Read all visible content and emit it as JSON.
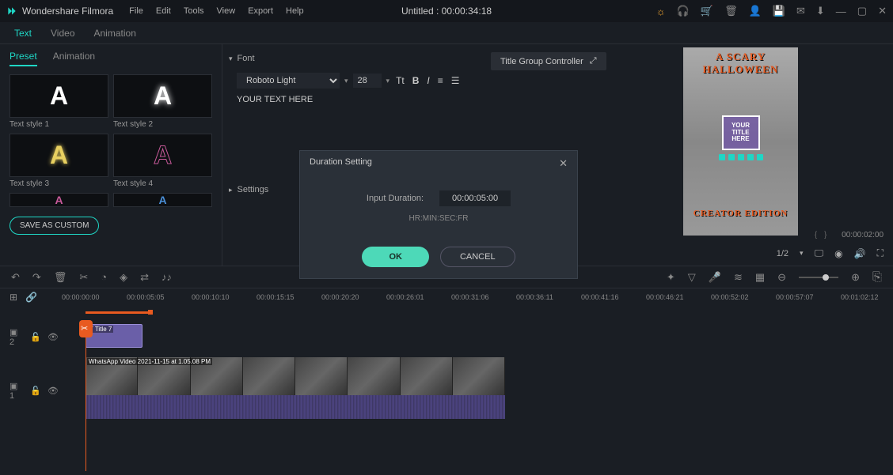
{
  "titlebar": {
    "app_name": "Wondershare Filmora",
    "menu": [
      "File",
      "Edit",
      "Tools",
      "View",
      "Export",
      "Help"
    ],
    "document_title": "Untitled : 00:00:34:18"
  },
  "main_tabs": {
    "items": [
      "Text",
      "Video",
      "Animation"
    ],
    "active": "Text"
  },
  "sub_tabs": {
    "items": [
      "Preset",
      "Animation"
    ],
    "active": "Preset"
  },
  "presets": [
    {
      "label": "Text style 1",
      "glyph": "A",
      "color": "#ffffff"
    },
    {
      "label": "Text style 2",
      "glyph": "A",
      "color": "#ffffff"
    },
    {
      "label": "Text style 3",
      "glyph": "A",
      "color": "#e8d060"
    },
    {
      "label": "Text style 4",
      "glyph": "A",
      "color": "#c85a9a"
    }
  ],
  "save_custom_label": "SAVE AS CUSTOM",
  "font_panel": {
    "section_label": "Font",
    "font_family": "Roboto Light",
    "font_size": "28",
    "text_value": "YOUR TEXT HERE",
    "settings_label": "Settings"
  },
  "preview": {
    "title_group_label": "Title Group Controller",
    "overlay_line1": "A SCARY",
    "overlay_line2": "HALLOWEEN",
    "title_box_l1": "YOUR",
    "title_box_l2": "TITLE",
    "title_box_l3": "HERE",
    "creator_edition": "CREATOR EDITION",
    "current_time": "00:00:02:00",
    "page_indicator": "1/2"
  },
  "timeline": {
    "ruler_ticks": [
      "00:00:00:00",
      "00:00:05:05",
      "00:00:10:10",
      "00:00:15:15",
      "00:00:20:20",
      "00:00:26:01",
      "00:00:31:06",
      "00:00:36:11",
      "00:00:41:16",
      "00:00:46:21",
      "00:00:52:02",
      "00:00:57:07",
      "00:01:02:12"
    ],
    "title_clip_label": "T Title 7",
    "video_clip_label": "WhatsApp Video 2021-11-15 at 1.05.08 PM",
    "track2_id": "2",
    "track1_id": "1"
  },
  "modal": {
    "title": "Duration Setting",
    "input_label": "Input Duration:",
    "duration_value": "00:00:05:00",
    "hint": "HR:MIN:SEC:FR",
    "ok_label": "OK",
    "cancel_label": "CANCEL"
  }
}
